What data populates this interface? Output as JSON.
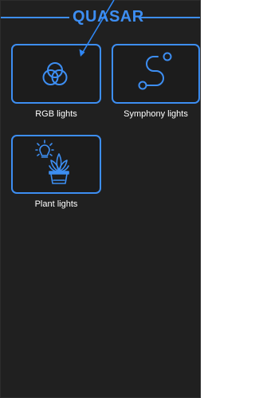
{
  "header": {
    "title": "QUASAR"
  },
  "colors": {
    "accent": "#3d8ef2",
    "background": "#202020",
    "label": "#ffffff"
  },
  "tiles": [
    {
      "label": "RGB lights",
      "icon": "rgb-circles-icon"
    },
    {
      "label": "Symphony lights",
      "icon": "symphony-path-icon"
    },
    {
      "label": "Plant lights",
      "icon": "plant-light-icon"
    }
  ]
}
